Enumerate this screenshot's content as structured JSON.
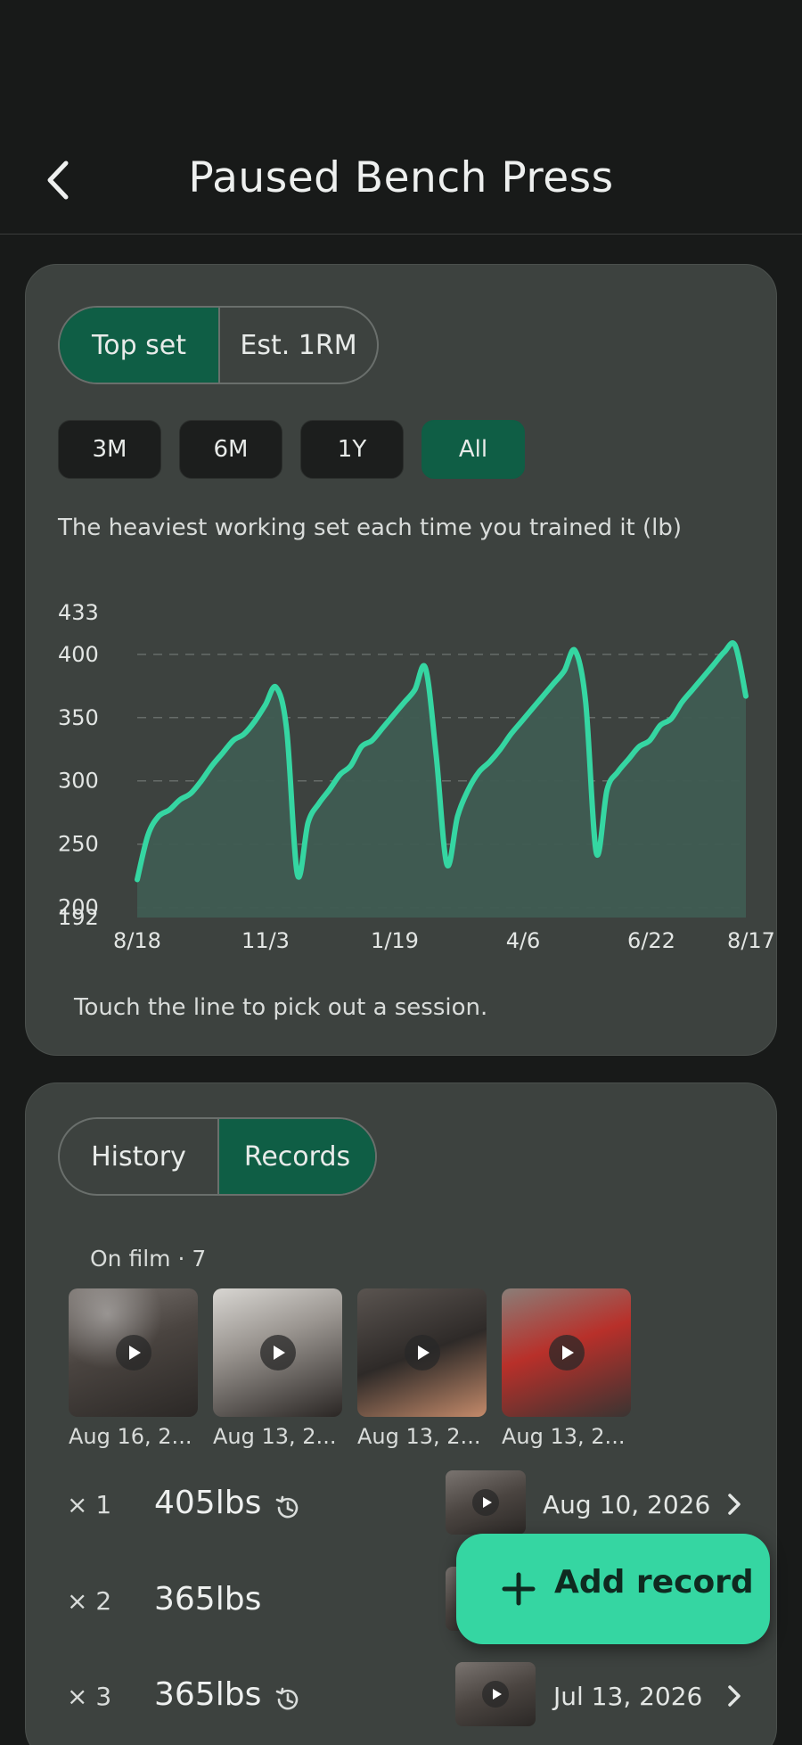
{
  "header": {
    "title": "Paused Bench Press",
    "back_icon": "chevron-left-icon"
  },
  "chart_card": {
    "metric_toggle": [
      "Top set",
      "Est. 1RM"
    ],
    "metric_selected": "Top set",
    "ranges": [
      "3M",
      "6M",
      "1Y",
      "All"
    ],
    "range_selected": "All",
    "description": "The heaviest working set each time you trained it (lb)",
    "hint": "Touch the line to pick out a session.",
    "colors": {
      "line": "#35d6a2",
      "area": "#3f5c52",
      "grid": "#666c69"
    }
  },
  "chart_data": {
    "type": "area",
    "ylim": [
      192,
      433
    ],
    "yticks": [
      200,
      250,
      300,
      350,
      400
    ],
    "yextremes": [
      192,
      433
    ],
    "xtick_labels": [
      "8/18",
      "11/3",
      "1/19",
      "4/6",
      "6/22",
      "8/17"
    ],
    "grid": true,
    "values": [
      222,
      257,
      272,
      277,
      285,
      290,
      300,
      312,
      322,
      332,
      337,
      347,
      360,
      374,
      340,
      226,
      267,
      282,
      293,
      305,
      312,
      327,
      332,
      342,
      352,
      362,
      372,
      389,
      320,
      234,
      272,
      293,
      307,
      315,
      325,
      337,
      347,
      357,
      367,
      377,
      387,
      403,
      362,
      243,
      293,
      307,
      317,
      327,
      332,
      344,
      349,
      362,
      372,
      382,
      392,
      402,
      407,
      367
    ]
  },
  "records_card": {
    "tabs": [
      "History",
      "Records"
    ],
    "tab_selected": "Records",
    "film_label": "On film · 7",
    "film_thumbs": [
      {
        "date": "Aug 16, 2..."
      },
      {
        "date": "Aug 13, 2..."
      },
      {
        "date": "Aug 13, 2..."
      },
      {
        "date": "Aug 13, 2..."
      }
    ],
    "records": [
      {
        "reps": "× 1",
        "weight": "405lbs",
        "history_icon": true,
        "date": "Aug 10, 2026"
      },
      {
        "reps": "× 2",
        "weight": "365lbs",
        "history_icon": false,
        "date": ""
      },
      {
        "reps": "× 3",
        "weight": "365lbs",
        "history_icon": true,
        "date": "Jul 13, 2026"
      }
    ]
  },
  "fab": {
    "label": "Add record",
    "icon": "plus-icon"
  }
}
